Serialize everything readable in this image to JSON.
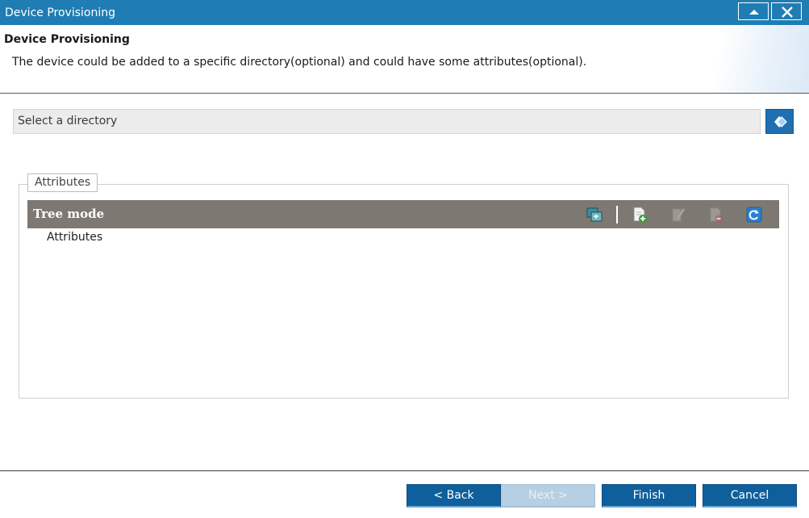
{
  "window": {
    "title": "Device Provisioning"
  },
  "header": {
    "title": "Device Provisioning",
    "description": "The device could be added to a specific directory(optional) and could have some attributes(optional)."
  },
  "directory": {
    "placeholder": "Select a directory",
    "browse_icon": "directory-picker-icon"
  },
  "attributes": {
    "legend": "Attributes",
    "tree_header": "Tree mode",
    "toolbar_icons": [
      "switch-mode-icon",
      "add-attribute-icon",
      "edit-attribute-icon",
      "delete-attribute-icon",
      "refresh-icon"
    ],
    "items": [
      "Attributes"
    ]
  },
  "buttons": {
    "back": "< Back",
    "next": "Next >",
    "finish": "Finish",
    "cancel": "Cancel"
  },
  "colors": {
    "accent": "#1f7db4",
    "button": "#0f5f9c",
    "button_disabled": "#b6cfe2",
    "tree_header": "#7d7972"
  }
}
